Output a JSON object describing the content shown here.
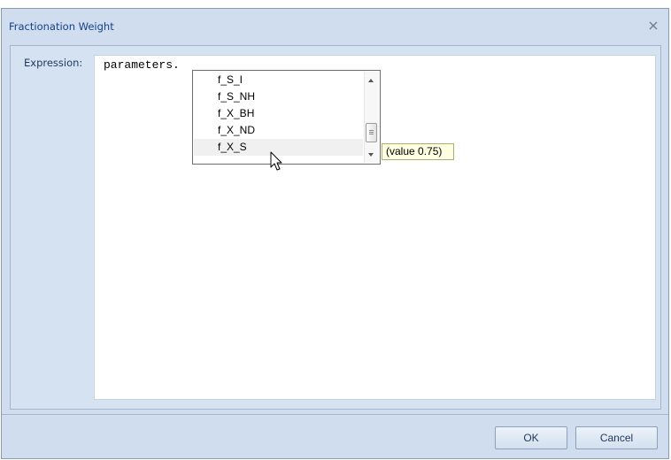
{
  "dialog": {
    "title": "Fractionation Weight"
  },
  "expression": {
    "label": "Expression:",
    "text": "parameters."
  },
  "autocomplete": {
    "items": [
      "f_S_I",
      "f_S_NH",
      "f_X_BH",
      "f_X_ND",
      "f_X_S"
    ],
    "selected": "f_X_S",
    "tooltip": "(value 0.75)"
  },
  "buttons": {
    "ok": "OK",
    "cancel": "Cancel"
  },
  "icons": {
    "close": "close-icon",
    "cursor": "mouse-pointer-icon"
  }
}
